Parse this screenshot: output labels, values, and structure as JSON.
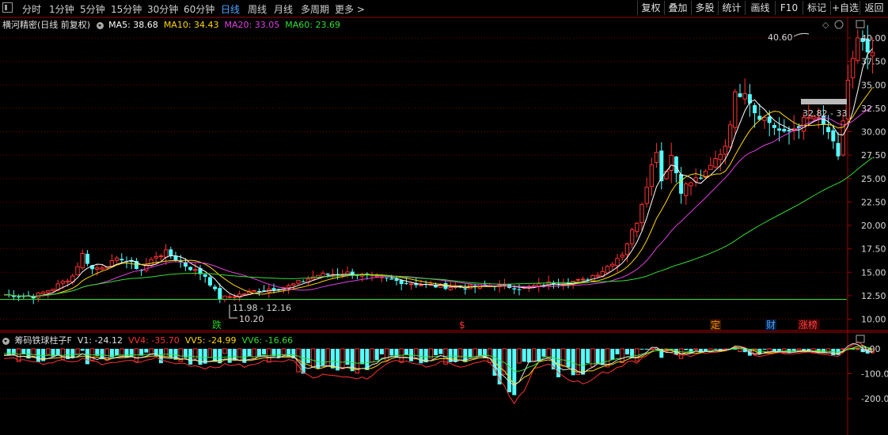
{
  "toolbar": {
    "periods": [
      "分时",
      "1分钟",
      "5分钟",
      "15分钟",
      "30分钟",
      "60分钟",
      "日线",
      "周线",
      "月线",
      "多周期",
      "更多"
    ],
    "active_period": "日线",
    "more_arrow": ">",
    "right_tools": [
      "复权",
      "叠加",
      "多股",
      "统计",
      "画线",
      "F10",
      "标记",
      "+自选",
      "返回"
    ]
  },
  "main_chart": {
    "title": "横河精密(日线 前复权)",
    "ma": [
      {
        "label": "MA5: 38.68",
        "color": "#ffffff"
      },
      {
        "label": "MA10: 34.43",
        "color": "#ffd700"
      },
      {
        "label": "MA20: 33.05",
        "color": "#e040e0"
      },
      {
        "label": "MA60: 23.69",
        "color": "#33dd33"
      }
    ],
    "price_axis": [
      "40.00",
      "37.50",
      "35.00",
      "32.50",
      "30.00",
      "27.50",
      "25.00",
      "22.50",
      "20.00",
      "17.50",
      "15.00",
      "12.50",
      "10.00"
    ],
    "annotations": {
      "high": "40.60",
      "low": "10.20",
      "range": "11.98 - 12.16",
      "current": "32.82 - 33"
    },
    "event_markers": [
      {
        "text": "跌",
        "color": "#22cc22"
      },
      {
        "text": "$",
        "color": "#ff3333"
      },
      {
        "text": "定",
        "color": "#ff8c00"
      },
      {
        "text": "财",
        "color": "#4ea3ff"
      },
      {
        "text": "涨榜",
        "color": "#ff4444"
      }
    ]
  },
  "indicator": {
    "title": "筹码铁球柱子F",
    "values": [
      {
        "label": "V1: -24.12",
        "color": "#e0e0e0"
      },
      {
        "label": "VV4: -35.70",
        "color": "#ff3030"
      },
      {
        "label": "VV5: -24.99",
        "color": "#ffd700"
      },
      {
        "label": "VV6: -16.66",
        "color": "#33dd33"
      }
    ],
    "axis": [
      "0.00",
      "-100.0",
      "-200.0"
    ]
  },
  "colors": {
    "up": "#ff3232",
    "down": "#54ffff",
    "grid": "#7a0000",
    "ma5": "#ffffff",
    "ma10": "#ffd700",
    "ma20": "#e040e0",
    "ma60": "#33dd33"
  }
}
